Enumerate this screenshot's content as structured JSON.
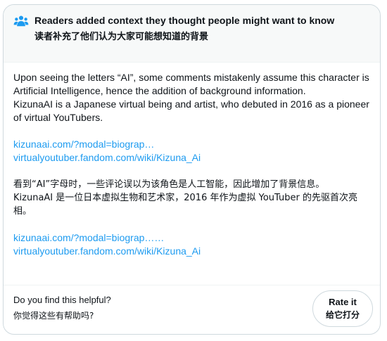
{
  "header": {
    "icon": "people-icon",
    "title": "Readers added context they thought people might want to know",
    "subtitle": "读者补充了他们认为大家可能想知道的背景"
  },
  "note": {
    "en_paragraph_1": "Upon seeing the letters “AI”, some comments mistakenly assume this character is Artificial Intelligence, hence the addition of background information.",
    "en_paragraph_2": "KizunaAI is a Japanese virtual being and artist, who debuted in 2016 as a pioneer of virtual YouTubers.",
    "links_1": [
      "kizunaai.com/?modal=biograp…",
      "virtualyoutuber.fandom.com/wiki/Kizuna_Ai"
    ],
    "cn_paragraph_1": "看到“AI”字母时，一些评论误以为该角色是人工智能，因此增加了背景信息。",
    "cn_paragraph_2": "KizunaAI 是一位日本虚拟生物和艺术家，2016 年作为虚拟 YouTuber 的先驱首次亮相。",
    "links_2": [
      "kizunaai.com/?modal=biograp……",
      "virtualyoutuber.fandom.com/wiki/Kizuna_Ai"
    ]
  },
  "footer": {
    "question": "Do you find this helpful?",
    "question_cn": "你觉得这些有帮助吗?",
    "rate_label": "Rate it",
    "rate_label_cn": "给它打分"
  },
  "colors": {
    "accent": "#1d9bf0",
    "text": "#0f1419",
    "header_bg": "#f7f9f9",
    "border": "#cfd9de"
  }
}
